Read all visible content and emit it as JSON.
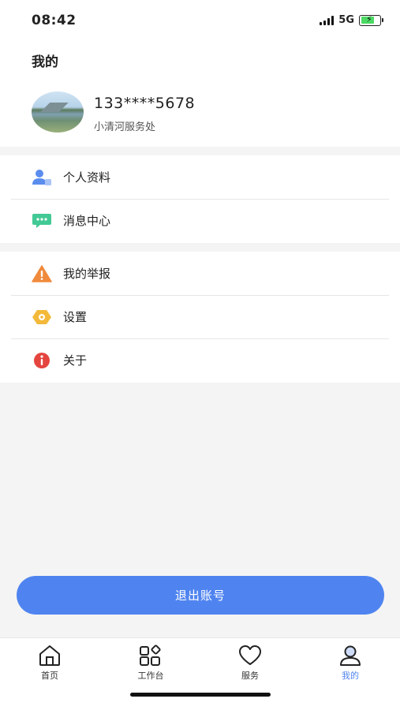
{
  "status_bar": {
    "time": "08:42",
    "network": "5G"
  },
  "header": {
    "title": "我的"
  },
  "user": {
    "phone": "133****5678",
    "org": "小清河服务处"
  },
  "menu_group_1": [
    {
      "label": "个人资料",
      "icon": "user-profile-icon",
      "color": "#5b8def"
    },
    {
      "label": "消息中心",
      "icon": "message-icon",
      "color": "#43c995"
    }
  ],
  "menu_group_2": [
    {
      "label": "我的举报",
      "icon": "warning-icon",
      "color": "#f08a3c"
    },
    {
      "label": "设置",
      "icon": "settings-icon",
      "color": "#f3b93a"
    },
    {
      "label": "关于",
      "icon": "info-icon",
      "color": "#e5453f"
    }
  ],
  "logout_label": "退出账号",
  "tabs": [
    {
      "label": "首页",
      "icon": "home-icon"
    },
    {
      "label": "工作台",
      "icon": "workbench-icon"
    },
    {
      "label": "服务",
      "icon": "heart-icon"
    },
    {
      "label": "我的",
      "icon": "profile-icon",
      "active": true
    }
  ],
  "colors": {
    "accent": "#4f84f0",
    "background": "#f4f4f4"
  }
}
